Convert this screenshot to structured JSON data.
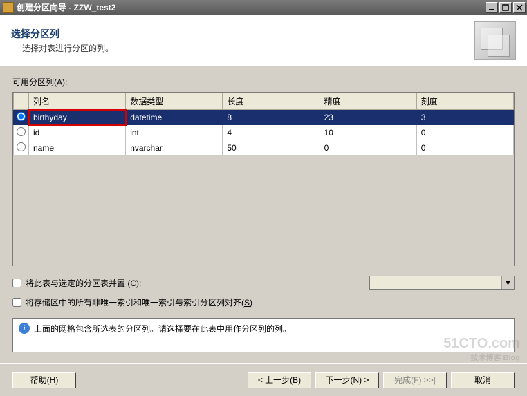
{
  "window": {
    "title": "创建分区向导 - ZZW_test2"
  },
  "header": {
    "title": "选择分区列",
    "subtitle": "选择对表进行分区的列。"
  },
  "table": {
    "label_html": "可用分区列(<u>A</u>):",
    "headers": {
      "col1": "列名",
      "col2": "数据类型",
      "col3": "长度",
      "col4": "精度",
      "col5": "刻度"
    },
    "rows": [
      {
        "selected": true,
        "name": "birthyday",
        "type": "datetime",
        "len": "8",
        "prec": "23",
        "scale": "3"
      },
      {
        "selected": false,
        "name": "id",
        "type": "int",
        "len": "4",
        "prec": "10",
        "scale": "0"
      },
      {
        "selected": false,
        "name": "name",
        "type": "nvarchar",
        "len": "50",
        "prec": "0",
        "scale": "0"
      }
    ]
  },
  "checkboxes": {
    "collocate_html": "将此表与选定的分区表并置 (<u>C</u>):",
    "align_html": "将存储区中的所有非唯一索引和唯一索引与索引分区列对齐(<u>S</u>)"
  },
  "info": {
    "text": "上面的网格包含所选表的分区列。请选择要在此表中用作分区列的列。"
  },
  "buttons": {
    "help_html": "帮助(<u>H</u>)",
    "back_html": "< 上一步(<u>B</u>)",
    "next_html": "下一步(<u>N</u>) >",
    "finish_html": "完成(<u>F</u>) >>|",
    "cancel": "取消"
  },
  "watermark": {
    "line1": "51CTO.com",
    "line2": "技术博客 Blog"
  }
}
